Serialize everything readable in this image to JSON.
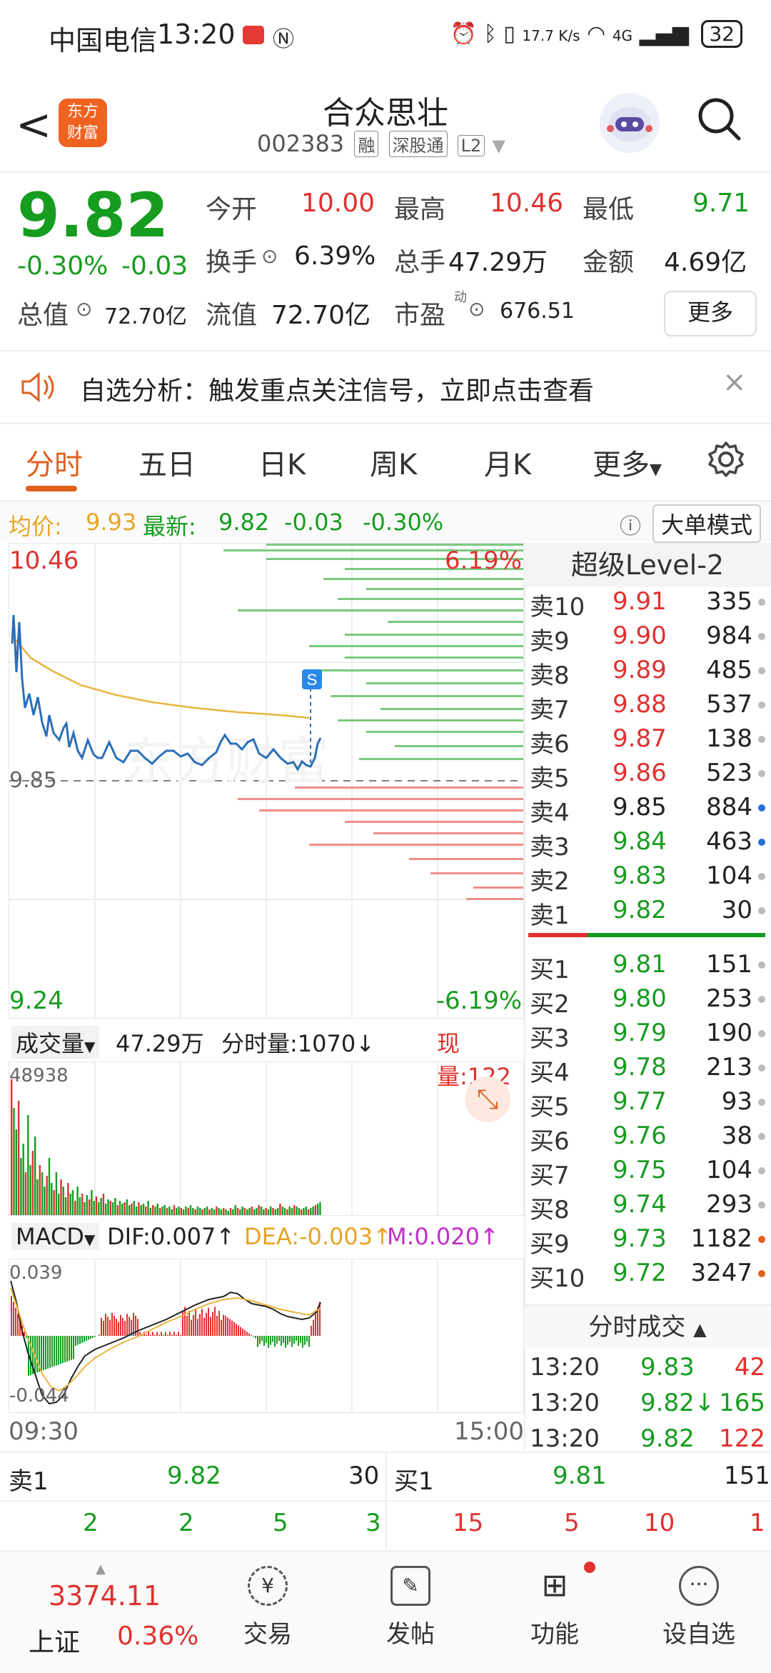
{
  "status_bar": {
    "carrier": "中国电信",
    "time": "13:20",
    "net_speed": "17.7 K/s",
    "signal": "4G",
    "battery": "32"
  },
  "header": {
    "back": "<",
    "logo_top": "东方",
    "logo_bottom": "财富",
    "name": "合众思壮",
    "code": "002383",
    "tags": [
      "融",
      "深股通",
      "L2"
    ]
  },
  "quote": {
    "price": "9.82",
    "change_pct": "-0.30%",
    "change": "-0.03",
    "open_label": "今开",
    "open": "10.00",
    "high_label": "最高",
    "high": "10.46",
    "low_label": "最低",
    "low": "9.71",
    "turnover_label": "换手",
    "turnover": "6.39%",
    "volume_label": "总手",
    "volume": "47.29万",
    "amount_label": "金额",
    "amount": "4.69亿",
    "mcap_label": "总值",
    "mcap": "72.70亿",
    "float_label": "流值",
    "float": "72.70亿",
    "pe_label": "市盈",
    "pe_sup": "动",
    "pe": "676.51",
    "more": "更多"
  },
  "banner": {
    "text": "自选分析：触发重点关注信号，立即点击查看",
    "close": "×"
  },
  "tabs": [
    "分时",
    "五日",
    "日K",
    "周K",
    "月K",
    "更多"
  ],
  "avg_line": {
    "avg_label": "均价:",
    "avg": "9.93",
    "latest_label": "最新:",
    "latest": "9.82",
    "chg": "-0.03",
    "pct": "-0.30%",
    "big_order": "大单模式"
  },
  "chart": {
    "high": "10.46",
    "low": "9.24",
    "high_pct": "6.19%",
    "low_pct": "-6.19%",
    "ref": "9.85",
    "start_time": "09:30",
    "end_time": "15:00",
    "s_marker": "S",
    "watermark": "东方财富",
    "volume_label": "成交量",
    "volume_total": "47.29万",
    "min_vol": "分时量:1070↓",
    "cur_vol": "现量:122",
    "vol_max": "48938",
    "macd_label": "MACD",
    "dif": "DIF:0.007↑",
    "dea": "DEA:-0.003↑",
    "m": "M:0.020↑",
    "macd_max": "0.039",
    "macd_min": "-0.044"
  },
  "order_book": {
    "title": "超级Level-2",
    "sells": [
      {
        "n": "卖10",
        "p": "9.91",
        "v": "335",
        "c": "red",
        "dot": "gray"
      },
      {
        "n": "卖9",
        "p": "9.90",
        "v": "984",
        "c": "red",
        "dot": "gray"
      },
      {
        "n": "卖8",
        "p": "9.89",
        "v": "485",
        "c": "red",
        "dot": "gray"
      },
      {
        "n": "卖7",
        "p": "9.88",
        "v": "537",
        "c": "red",
        "dot": "gray"
      },
      {
        "n": "卖6",
        "p": "9.87",
        "v": "138",
        "c": "red",
        "dot": "gray"
      },
      {
        "n": "卖5",
        "p": "9.86",
        "v": "523",
        "c": "red",
        "dot": "gray"
      },
      {
        "n": "卖4",
        "p": "9.85",
        "v": "884",
        "c": "dark",
        "dot": "blue"
      },
      {
        "n": "卖3",
        "p": "9.84",
        "v": "463",
        "c": "green",
        "dot": "blue"
      },
      {
        "n": "卖2",
        "p": "9.83",
        "v": "104",
        "c": "green",
        "dot": "gray"
      },
      {
        "n": "卖1",
        "p": "9.82",
        "v": "30",
        "c": "green",
        "dot": "gray"
      }
    ],
    "buys": [
      {
        "n": "买1",
        "p": "9.81",
        "v": "151",
        "c": "green",
        "dot": "gray"
      },
      {
        "n": "买2",
        "p": "9.80",
        "v": "253",
        "c": "green",
        "dot": "gray"
      },
      {
        "n": "买3",
        "p": "9.79",
        "v": "190",
        "c": "green",
        "dot": "gray"
      },
      {
        "n": "买4",
        "p": "9.78",
        "v": "213",
        "c": "green",
        "dot": "gray"
      },
      {
        "n": "买5",
        "p": "9.77",
        "v": "93",
        "c": "green",
        "dot": "gray"
      },
      {
        "n": "买6",
        "p": "9.76",
        "v": "38",
        "c": "green",
        "dot": "gray"
      },
      {
        "n": "买7",
        "p": "9.75",
        "v": "104",
        "c": "green",
        "dot": "gray"
      },
      {
        "n": "买8",
        "p": "9.74",
        "v": "293",
        "c": "green",
        "dot": "gray"
      },
      {
        "n": "买9",
        "p": "9.73",
        "v": "1182",
        "c": "green",
        "dot": "orange"
      },
      {
        "n": "买10",
        "p": "9.72",
        "v": "3247",
        "c": "green",
        "dot": "orange"
      }
    ]
  },
  "trades": {
    "title": "分时成交",
    "rows": [
      {
        "t": "13:20",
        "p": "9.83",
        "v": "42",
        "vc": "red"
      },
      {
        "t": "13:20",
        "p": "9.82↓",
        "v": "165",
        "vc": "green"
      },
      {
        "t": "13:20",
        "p": "9.82",
        "v": "122",
        "vc": "red"
      }
    ]
  },
  "bottom_bar": {
    "sell1_label": "卖1",
    "sell1_price": "9.82",
    "sell1_vol": "30",
    "buy1_label": "买1",
    "buy1_price": "9.81",
    "buy1_vol": "151",
    "sell_split": [
      "2",
      "2",
      "5",
      "3"
    ],
    "buy_split": [
      "15",
      "5",
      "10",
      "1"
    ]
  },
  "nav": {
    "index_value": "3374.11",
    "index_name": "上证",
    "index_pct": "0.36%",
    "items": [
      "交易",
      "发帖",
      "功能",
      "设自选"
    ]
  }
}
